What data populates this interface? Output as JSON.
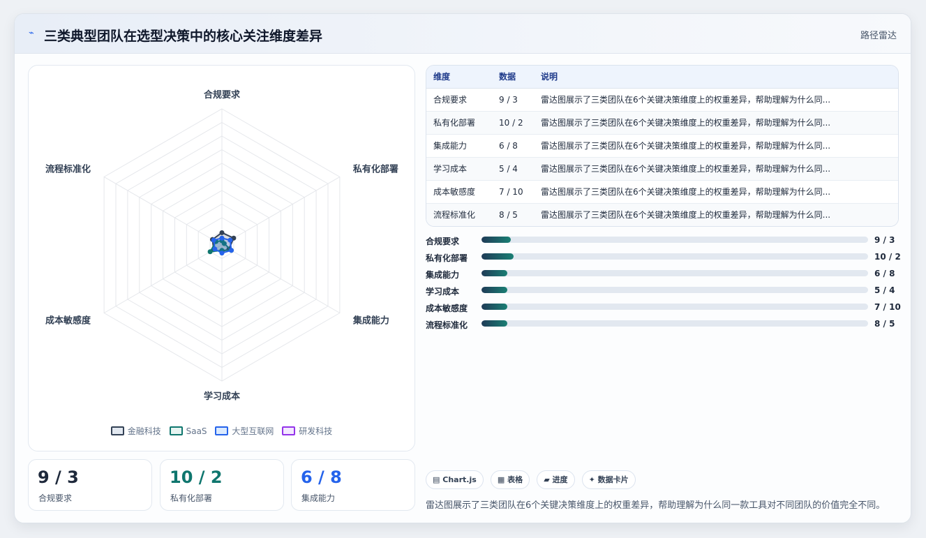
{
  "header": {
    "icon": "bolt-icon",
    "title": "三类典型团队在选型决策中的核心关注维度差异",
    "tag": "路径雷达"
  },
  "chart_data": {
    "type": "radar",
    "axes": [
      "合规要求",
      "私有化部署",
      "集成能力",
      "学习成本",
      "成本敏感度",
      "流程标准化"
    ],
    "rmax": 100,
    "rings": 10,
    "series": [
      {
        "name": "金融科技",
        "values": [
          9,
          10,
          6,
          5,
          7,
          8
        ],
        "color": "#334155"
      },
      {
        "name": "SaaS",
        "values": [
          3,
          2,
          8,
          4,
          10,
          5
        ],
        "color": "#0f766e"
      },
      {
        "name": "大型互联网",
        "values": [
          5,
          7,
          8,
          6,
          6,
          7
        ],
        "color": "#2563eb"
      },
      {
        "name": "研发科技",
        "values": [],
        "color": "#9333ea"
      }
    ],
    "legend_position": "bottom",
    "grid": true
  },
  "stats": [
    {
      "value": "9 / 3",
      "label": "合规要求",
      "color": "#1e293b"
    },
    {
      "value": "10 / 2",
      "label": "私有化部署",
      "color": "#0f766e"
    },
    {
      "value": "6 / 8",
      "label": "集成能力",
      "color": "#2563eb"
    }
  ],
  "table": {
    "headers": [
      "维度",
      "数据",
      "说明"
    ],
    "rows": [
      {
        "dim": "合规要求",
        "val": "9 / 3",
        "desc": "雷达图展示了三类团队在6个关键决策维度上的权重差异，帮助理解为什么同..."
      },
      {
        "dim": "私有化部署",
        "val": "10 / 2",
        "desc": "雷达图展示了三类团队在6个关键决策维度上的权重差异，帮助理解为什么同..."
      },
      {
        "dim": "集成能力",
        "val": "6 / 8",
        "desc": "雷达图展示了三类团队在6个关键决策维度上的权重差异，帮助理解为什么同..."
      },
      {
        "dim": "学习成本",
        "val": "5 / 4",
        "desc": "雷达图展示了三类团队在6个关键决策维度上的权重差异，帮助理解为什么同..."
      },
      {
        "dim": "成本敏感度",
        "val": "7 / 10",
        "desc": "雷达图展示了三类团队在6个关键决策维度上的权重差异，帮助理解为什么同..."
      },
      {
        "dim": "流程标准化",
        "val": "8 / 5",
        "desc": "雷达图展示了三类团队在6个关键决策维度上的权重差异，帮助理解为什么同..."
      }
    ]
  },
  "bars": [
    {
      "label": "合规要求",
      "value": "9 / 3",
      "fill_percent": 7.5
    },
    {
      "label": "私有化部署",
      "value": "10 / 2",
      "fill_percent": 8.3
    },
    {
      "label": "集成能力",
      "value": "6 / 8",
      "fill_percent": 6.7
    },
    {
      "label": "学习成本",
      "value": "5 / 4",
      "fill_percent": 6.7
    },
    {
      "label": "成本敏感度",
      "value": "7 / 10",
      "fill_percent": 6.7
    },
    {
      "label": "流程标准化",
      "value": "8 / 5",
      "fill_percent": 6.7
    }
  ],
  "chips": [
    {
      "icon": "chart-icon",
      "glyph": "▤",
      "label": "Chart.js"
    },
    {
      "icon": "table-icon",
      "glyph": "▦",
      "label": "表格"
    },
    {
      "icon": "progress-icon",
      "glyph": "▰",
      "label": "进度"
    },
    {
      "icon": "sparkle-icon",
      "glyph": "✦",
      "label": "数据卡片"
    }
  ],
  "note": "雷达图展示了三类团队在6个关键决策维度上的权重差异，帮助理解为什么同一款工具对不同团队的价值完全不同。"
}
